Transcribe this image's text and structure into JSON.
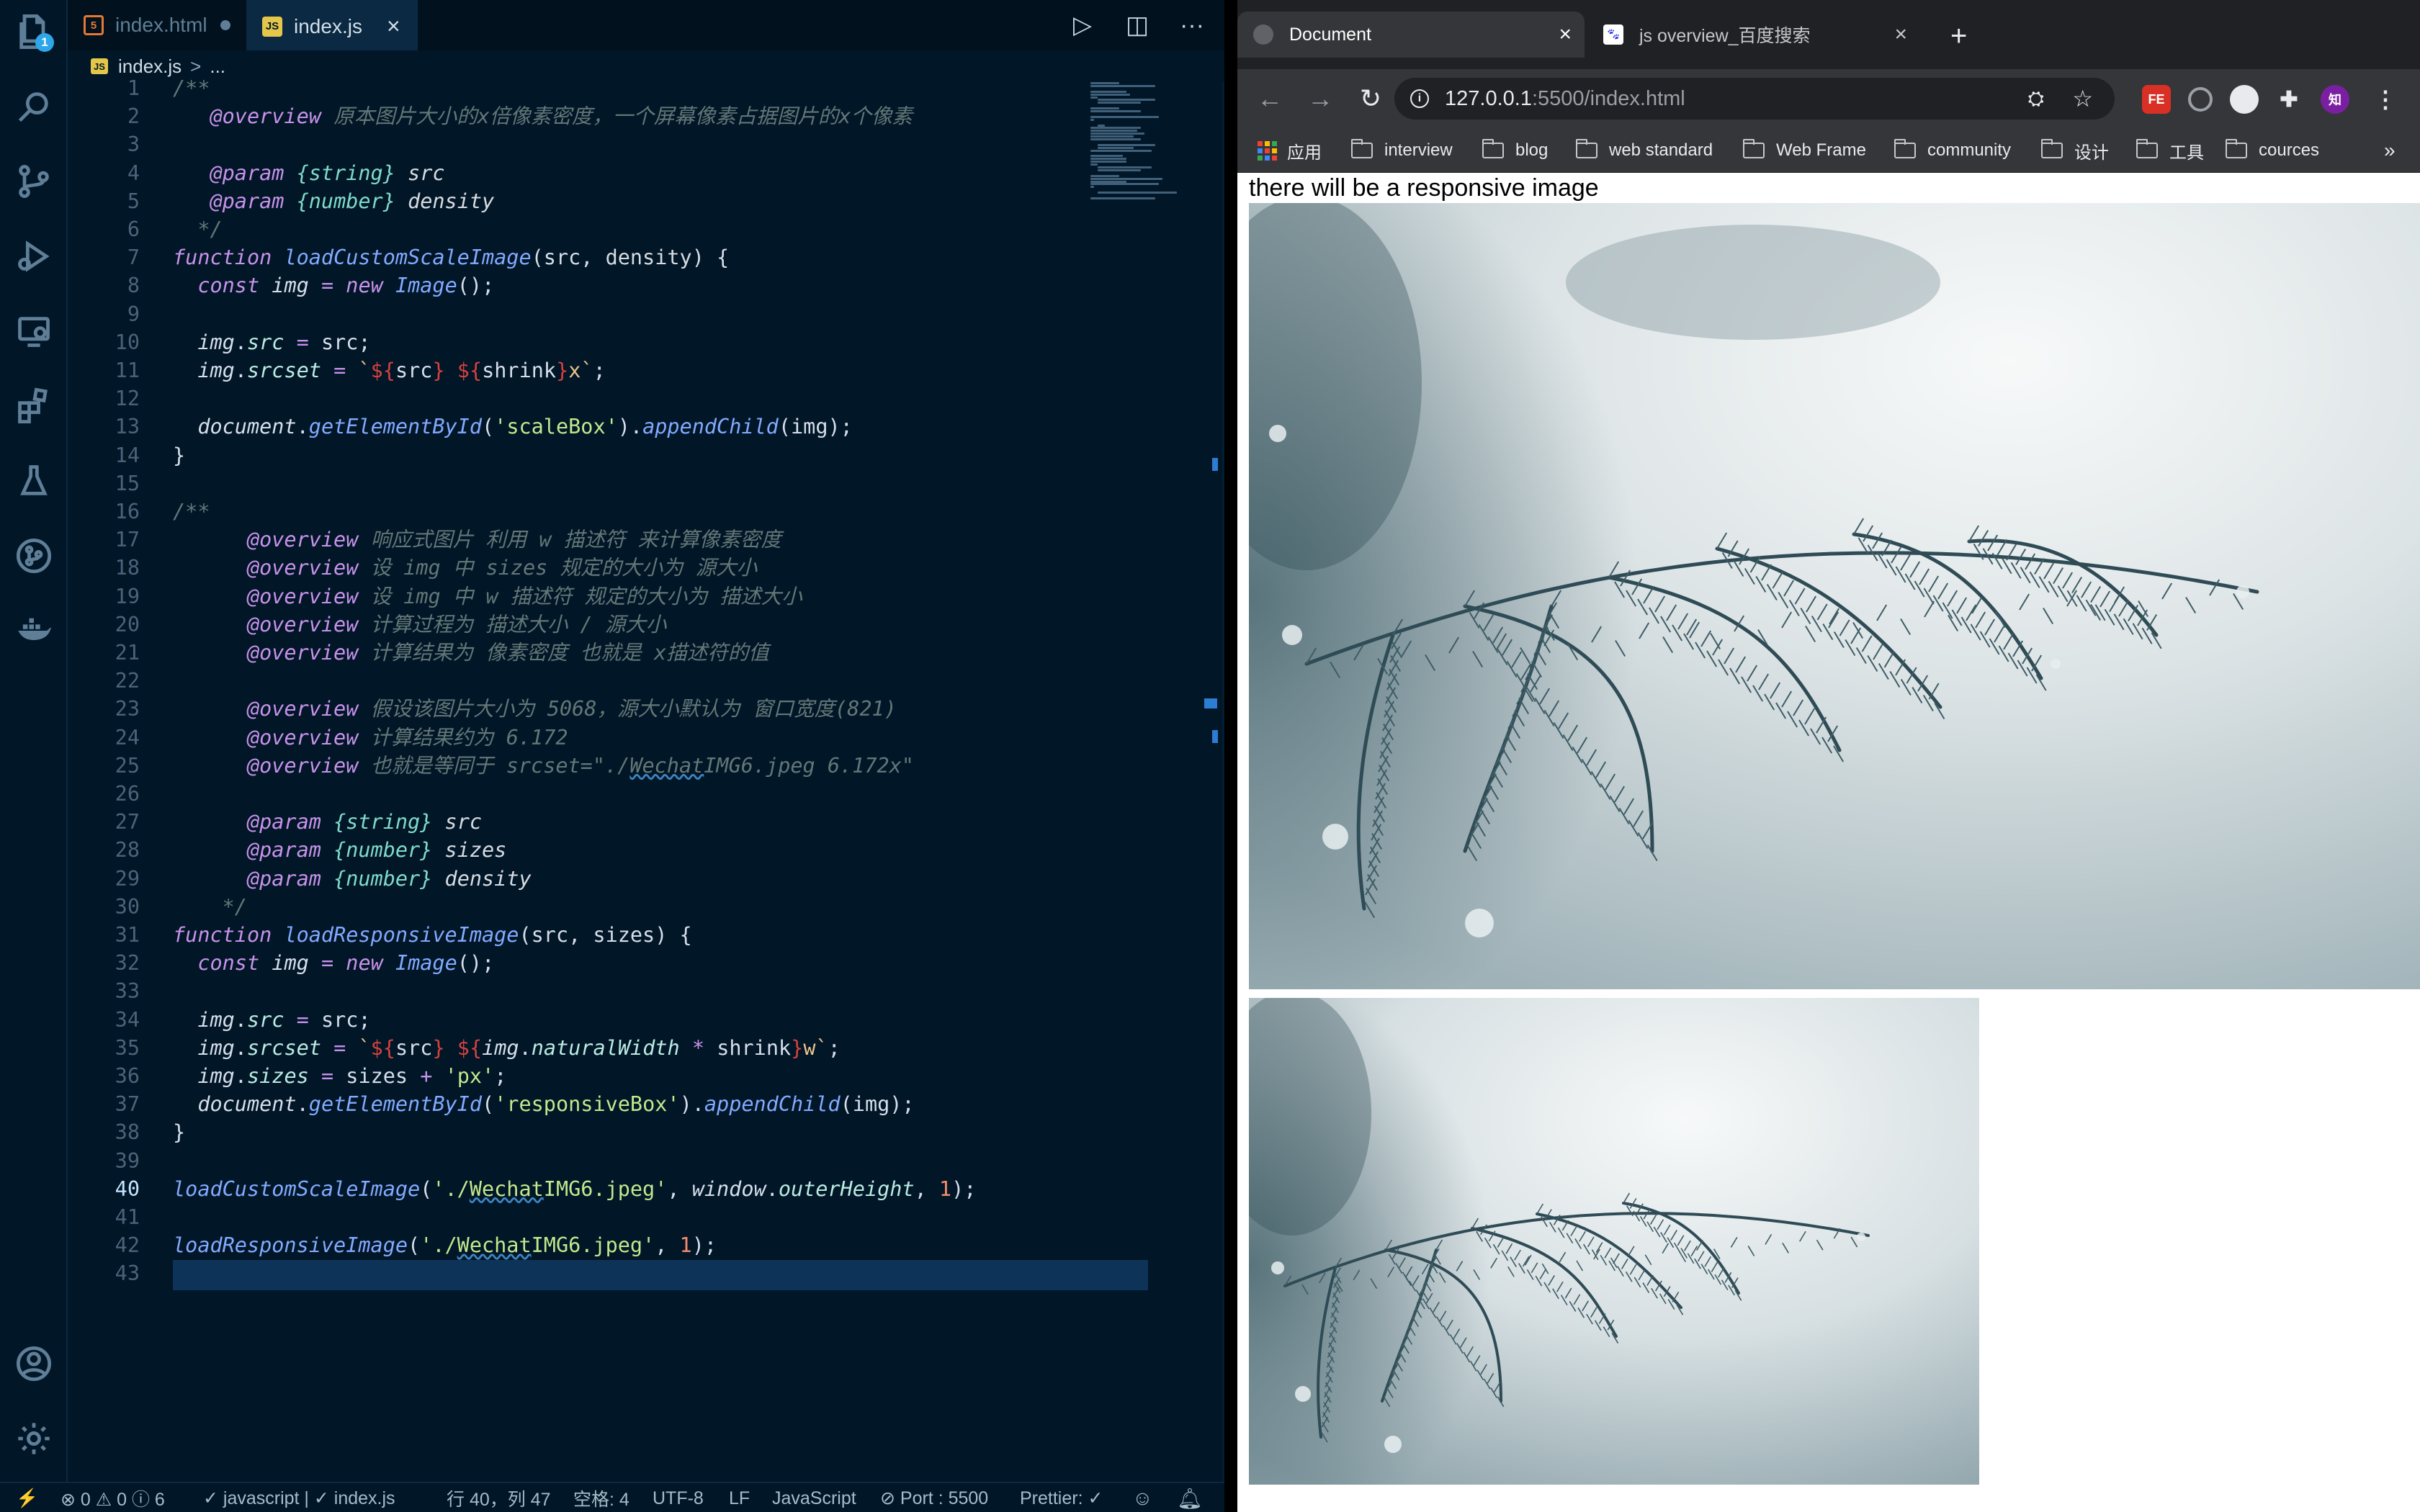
{
  "editor": {
    "activity_badge": "1",
    "tabs": [
      {
        "label": "index.html",
        "badge": "5",
        "dirty": true
      },
      {
        "label": "index.js",
        "badge": "JS",
        "close": "×"
      }
    ],
    "tab_actions": {
      "run": "▷",
      "split": "◫",
      "more": "···"
    },
    "breadcrumb": {
      "badge": "JS",
      "file": "index.js",
      "sep": ">",
      "rest": "..."
    },
    "line_numbers": [
      "1",
      "2",
      "3",
      "4",
      "5",
      "6",
      "7",
      "8",
      "9",
      "10",
      "11",
      "12",
      "13",
      "14",
      "15",
      "16",
      "17",
      "18",
      "19",
      "20",
      "21",
      "22",
      "23",
      "24",
      "25",
      "26",
      "27",
      "28",
      "29",
      "30",
      "31",
      "32",
      "33",
      "34",
      "35",
      "36",
      "37",
      "38",
      "39",
      "40",
      "41",
      "42",
      "43"
    ],
    "active_line": "40",
    "status": {
      "remote": "⚡",
      "problems": "⊗ 0 ⚠ 0 ⓘ 6",
      "language_check": "✓ javascript | ✓ index.js",
      "cursor": "行 40，列 47",
      "spaces": "空格: 4",
      "encoding": "UTF-8",
      "eol": "LF",
      "language": "JavaScript",
      "port": "⊘ Port : 5500",
      "prettier": "Prettier: ✓"
    }
  },
  "browser": {
    "tabs": [
      {
        "label": "Document",
        "close": "×"
      },
      {
        "label": "js overview_百度搜索",
        "close": "×"
      }
    ],
    "new_tab": "+",
    "url_host": "127.0.0.1",
    "url_rest": ":5500/index.html",
    "bookmarks": [
      "应用",
      "interview",
      "blog",
      "web standard",
      "Web Frame",
      "community",
      "设计",
      "工具",
      "cources"
    ],
    "bookmarks_more": "»",
    "extensions": {
      "fe": "FE",
      "zhihu": "知"
    },
    "page": {
      "heading": "there will be a responsive image"
    }
  },
  "colors": {
    "editor_bg": "#011627",
    "accent": "#2da7ea",
    "browser_chrome": "#35363a",
    "line_highlight": "#0e3358"
  }
}
